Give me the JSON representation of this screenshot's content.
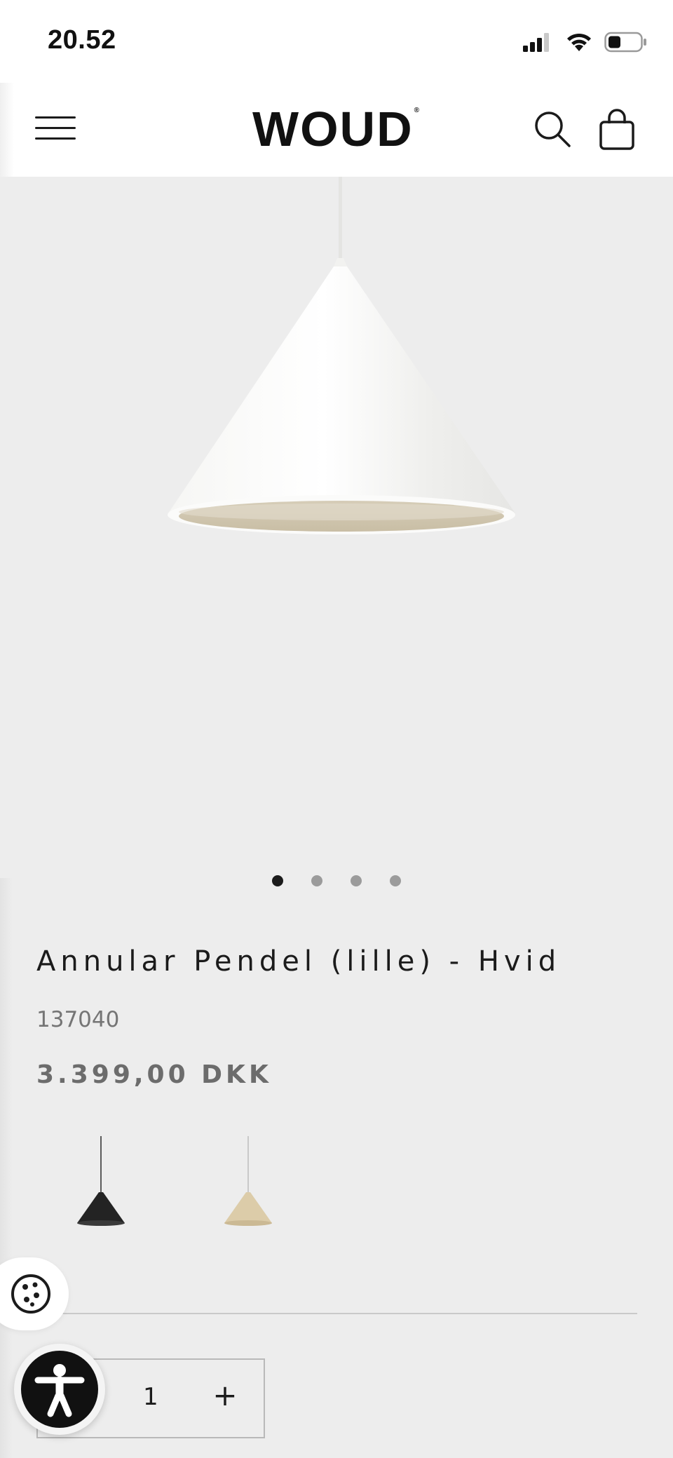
{
  "status_bar": {
    "time": "20.52",
    "icons": [
      "cellular-signal-icon",
      "wifi-icon",
      "battery-icon"
    ]
  },
  "header": {
    "logo_text": "WOUD",
    "logo_mark": "®",
    "icons": [
      "hamburger-menu-icon",
      "search-icon",
      "shopping-bag-icon"
    ]
  },
  "gallery": {
    "image_alt": "Annular Pendel (lille) - Hvid",
    "slide_count": 4,
    "active_slide": 1
  },
  "product": {
    "title": "Annular Pendel (lille) - Hvid",
    "sku": "137040",
    "price": "3.399,00 DKK",
    "variants": [
      {
        "name": "black",
        "color": "#1f1f1f"
      },
      {
        "name": "sand",
        "color": "#d9c9a8"
      }
    ]
  },
  "quantity": {
    "value": "1",
    "increase_label": "+"
  },
  "widgets": {
    "cookie_icon": "cookie-icon",
    "accessibility_icon": "accessibility-person-icon"
  },
  "colors": {
    "background": "#ededed",
    "header_bg": "#ffffff",
    "text_primary": "#1b1b1b",
    "text_muted": "#757575",
    "dot_active": "#1b1b1b",
    "dot_inactive": "#9b9b9b"
  }
}
